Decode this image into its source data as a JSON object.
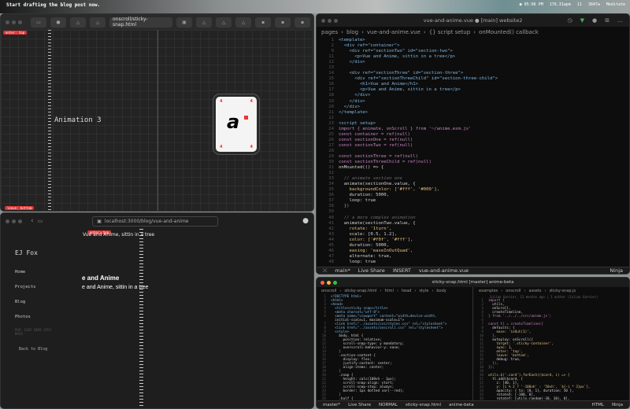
{
  "desktop": {
    "message": "Start drafting the blog post now.",
    "status": [
      "● 05:06 PM",
      "176.31wpm",
      "11",
      "3847w",
      "Meditate"
    ]
  },
  "browser1": {
    "url": "onscroll/sticky-snap.html",
    "heading": "Animation 3",
    "tag_top": "enter: top",
    "tag_bottom": "leave: bottom",
    "card_pip": "4",
    "card_logo": "a"
  },
  "browser2": {
    "url": "localhost:3000/blog/vue-and-anime",
    "line1": "Vue and Anime, sittin in a tree",
    "h1": "e and Anime",
    "p": "e and Anime, sittin in a tree",
    "site_title": "EJ Fox",
    "nav": [
      "Home",
      "Projects",
      "Blog",
      "Photos"
    ],
    "pgp": "PGP: E207 8E69 3FE3\n89C0",
    "back": "Back to Blog",
    "tag": "enter: top"
  },
  "editor1": {
    "title": "vue-and-anime.vue ● [main] website2",
    "breadcrumb": [
      "pages",
      "blog",
      "vue-and-anime.vue",
      "{} script setup",
      "onMounted() callback"
    ],
    "lines": [
      [
        "1",
        "<template>"
      ],
      [
        "2",
        "  <div ref=\"container\">"
      ],
      [
        "9",
        "    <div ref=\"sectionTwo\" id=\"section-two\">"
      ],
      [
        "11",
        "      <p>Vue and Anime, sittin in a tree</p>"
      ],
      [
        "12",
        "    </div>"
      ],
      [
        "13",
        ""
      ],
      [
        "14",
        "    <div ref=\"sectionThree\" id=\"section-three\">"
      ],
      [
        "15",
        "      <div ref=\"sectionThreeChild\" id=\"section-three-child\">"
      ],
      [
        "16",
        "        <h1>Vue and Anime</h1>"
      ],
      [
        "17",
        "        <p>Vue and Anime, sittin in a tree</p>"
      ],
      [
        "18",
        "      </div>"
      ],
      [
        "19",
        "    </div>"
      ],
      [
        "20",
        "  </div>"
      ],
      [
        "21",
        "</template>"
      ],
      [
        "22",
        ""
      ],
      [
        "23",
        "<script setup>"
      ],
      [
        "24",
        "import { animate, onScroll } from '~/anime.esm.js'"
      ],
      [
        "25",
        "const container = ref(null)"
      ],
      [
        "26",
        "const sectionOne = ref(null)"
      ],
      [
        "27",
        "const sectionTwo = ref(null)"
      ],
      [
        "28",
        ""
      ],
      [
        "29",
        "const sectionThree = ref(null)"
      ],
      [
        "30",
        "const sectionThreeChild = ref(null)"
      ],
      [
        "31",
        "onMounted(() => {"
      ],
      [
        "32",
        ""
      ],
      [
        "33",
        "  // animate section one"
      ],
      [
        "34",
        "  animate(sectionOne.value, {"
      ],
      [
        "35",
        "    backgroundColor: ['#fff', '#000'],"
      ],
      [
        "36",
        "    duration: 5000,"
      ],
      [
        "37",
        "    loop: true"
      ],
      [
        "38",
        "  })"
      ],
      [
        "39",
        ""
      ],
      [
        "40",
        "  // a more complex animation"
      ],
      [
        "41",
        "  animate(sectionTwo.value, {"
      ],
      [
        "42",
        "    rotate: '1turn',"
      ],
      [
        "43",
        "    scale: [0.5, 1.2],"
      ],
      [
        "44",
        "    color: ['#f0f', '#fff'],"
      ],
      [
        "45",
        "    duration: 5000,"
      ],
      [
        "46",
        "    easing: 'easeInOutQuad',"
      ],
      [
        "47",
        "    alternate: true,"
      ],
      [
        "48",
        "    loop: true"
      ]
    ],
    "status": [
      "main*",
      "Live Share",
      "INSERT",
      "vue-and-anime.vue",
      "Ninja"
    ]
  },
  "editor2": {
    "title": "sticky-snap.html [master] anime-beta",
    "left_breadcrumb": [
      "onscroll",
      "sticky-snap.html",
      "html",
      "head",
      "style",
      "body"
    ],
    "right_breadcrumb": [
      "examples",
      "onscroll",
      "assets",
      "sticky-snap.js"
    ],
    "blame": "Julian Garnier, 12 months ago | 1 author (Julian Garnier)",
    "left_lines": [
      [
        "1",
        "<!DOCTYPE html>"
      ],
      [
        "2",
        "<html>"
      ],
      [
        "3",
        "<head>"
      ],
      [
        "4",
        "  <title>sticky snap</title>"
      ],
      [
        "5",
        "  <meta charset=\"utf-8\">"
      ],
      [
        "6",
        "  <meta name=\"viewport\" content=\"width=device-width,"
      ],
      [
        "",
        "  initial-scale=1, maximum-scale=1\">"
      ],
      [
        "7",
        "  <link href=\"../assets/css/styles.css\" rel=\"stylesheet\">"
      ],
      [
        "8",
        "  <link href=\"../assets/onscroll.css\" rel=\"stylesheet\">"
      ],
      [
        "9",
        "  <style>"
      ],
      [
        "10",
        "    body, html {"
      ],
      [
        "11",
        "      position: relative;"
      ],
      [
        "12",
        "      scroll-snap-type: y mandatory;"
      ],
      [
        "13",
        "      overscroll-behavior-y: none;"
      ],
      [
        "14",
        "    }"
      ],
      [
        "15",
        "    .section-content {"
      ],
      [
        "16",
        "      display: flex;"
      ],
      [
        "17",
        "      justify-content: center;"
      ],
      [
        "18",
        "      align-items: center;"
      ],
      [
        "19",
        "    }"
      ],
      [
        "20",
        "    .snap {"
      ],
      [
        "21",
        "      height: calc(100vh - 1px);"
      ],
      [
        "22",
        "      scroll-snap-align: start;"
      ],
      [
        "23",
        "      scroll-snap-stop: always;"
      ],
      [
        "24",
        "      border: 1px dotted var(--red);"
      ],
      [
        "25",
        "    }"
      ],
      [
        "26",
        "    .half {"
      ]
    ],
    "right_lines": [
      [
        "1",
        "import {"
      ],
      [
        "2",
        "  utils,"
      ],
      [
        "3",
        "  onScroll,"
      ],
      [
        "4",
        "  createTimeline,"
      ],
      [
        "5",
        "} from '../../../src/anime.js';"
      ],
      [
        "6",
        ""
      ],
      [
        "7",
        "const tl = createTimeline({"
      ],
      [
        "8",
        "  defaults: {"
      ],
      [
        "9",
        "    ease: 'inOut(1)',"
      ],
      [
        "10",
        "  },"
      ],
      [
        "11",
        "  autoplay: onScroll({"
      ],
      [
        "12",
        "    target: '.sticky-container',"
      ],
      [
        "13",
        "    sync: 1,"
      ],
      [
        "14",
        "    enter: 'top',"
      ],
      [
        "15",
        "    leave: 'bottom',"
      ],
      [
        "16",
        "    debug: true,"
      ],
      [
        "17",
        "  }),"
      ],
      [
        "18",
        "});"
      ],
      [
        "19",
        ""
      ],
      [
        "20",
        "utils.$('.card').forEach(($card, i) => {"
      ],
      [
        "21",
        "  tl.add($card, {"
      ],
      [
        "22",
        "    z: [40, 1],"
      ],
      [
        "23",
        "    y: [i % 2 ? '-100vh' : '50vh', `${-i * 3}px`],"
      ],
      [
        "24",
        "    opacity: { to: [0, 1], duration: 50 },"
      ],
      [
        "25",
        "    rotateX: [-180, 0],"
      ],
      [
        "26",
        "    rotateY: [utils.random(-30, 30), 0],"
      ]
    ],
    "status": [
      "master*",
      "Live Share",
      "NORMAL",
      "sticky-snap.html",
      "anime-beta",
      "HTML",
      "Ninja"
    ]
  }
}
